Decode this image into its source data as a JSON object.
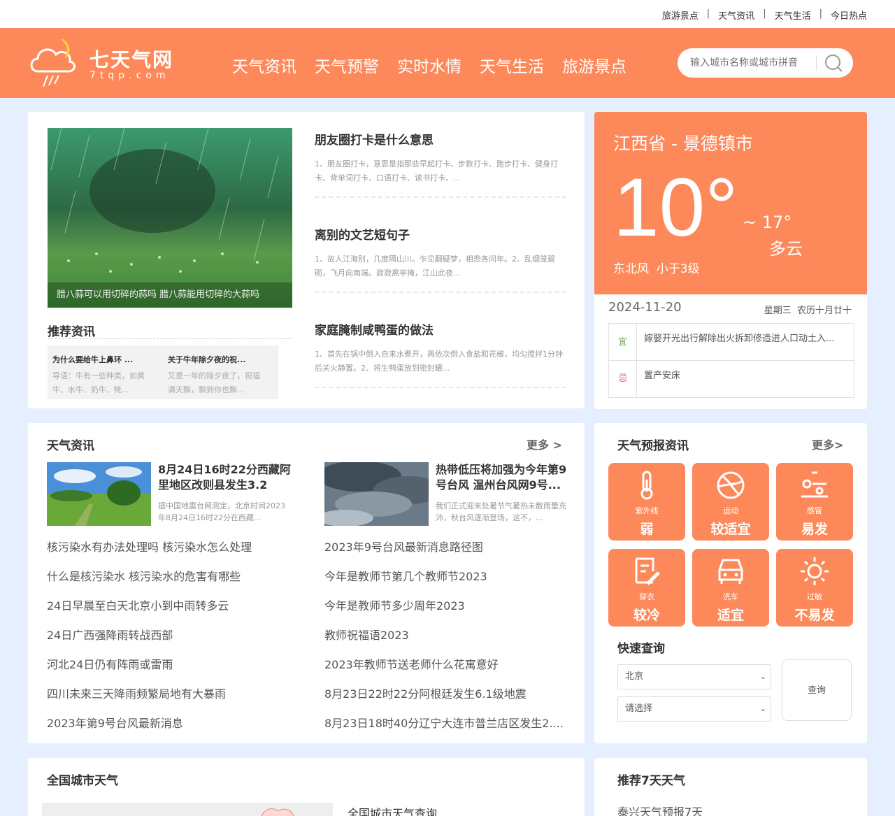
{
  "top_links": [
    "旅游景点",
    "天气资讯",
    "天气生活",
    "今日热点"
  ],
  "top_sep": "|",
  "logo": {
    "title": "七天气网",
    "sub": "7tqp.com"
  },
  "nav": [
    "天气资讯",
    "天气预警",
    "实时水情",
    "天气生活",
    "旅游景点"
  ],
  "search": {
    "placeholder": "输入城市名称或城市拼音"
  },
  "featured": {
    "caption": "腊八蒜可以用切碎的蒜吗 腊八蒜能用切碎的大蒜吗",
    "articles": [
      {
        "title": "朋友圈打卡是什么意思",
        "desc": "1、朋友圈打卡，意思是指那些早起打卡、步数打卡、跑步打卡、健身打卡、背单词打卡、口语打卡、读书打卡、..."
      },
      {
        "title": "离别的文艺短句子",
        "desc": "1、故人江海别，几度隔山川。乍见翻疑梦，相悲各问年。2、乱烟笼碧砌，飞月向南端。寂寂离亭掩，江山此夜..."
      },
      {
        "title": "家庭腌制咸鸭蛋的做法",
        "desc": "1、首先在锅中倒入自来水煮开，再依次倒入食盐和花椒，均匀搅拌1分钟后关火静置。2、将生鸭蛋放到密封罐..."
      }
    ],
    "rec_title": "推荐资讯",
    "rec_items": [
      {
        "title": "为什么要给牛上鼻环 ...",
        "desc": "导语：牛有一些种类，如黄牛、水牛、奶牛、牦..."
      },
      {
        "title": "关于牛年除夕夜的祝...",
        "desc": "又是一年的除夕夜了，祝福满天飘，飘到你也飘..."
      }
    ]
  },
  "weather": {
    "location": "江西省 - 景德镇市",
    "temp": "10°",
    "high": "~ 17°",
    "condition": "多云",
    "wind": "东北风  小于3级",
    "date": "2024-11-20",
    "weekday_lunar": "星期三  农历十月廿十",
    "yi_label": "宜",
    "yi_text": "嫁娶开光出行解除出火拆卸修造进人口动土入...",
    "ji_label": "忌",
    "ji_text": "置产安床",
    "accent": "#fd885a"
  },
  "news": {
    "title": "天气资讯",
    "more": "更多 >",
    "feature1": {
      "title": "8月24日16时22分西藏阿里地区改则县发生3.2级...",
      "desc": "据中国地震台网测定，北京时间2023年8月24日16时22分在西藏..."
    },
    "feature2": {
      "title": "热带低压将加强为今年第9号台风 温州台风网9号...",
      "desc": "我们正式迎来处暑节气暑热未散雨量充沛，秋台风逐渐登场，这不，..."
    },
    "left_list": [
      "核污染水有办法处理吗 核污染水怎么处理",
      "什么是核污染水 核污染水的危害有哪些",
      "24日早晨至白天北京小到中雨转多云",
      "24日广西强降雨转战西部",
      "河北24日仍有阵雨或雷雨",
      "四川未来三天降雨频繁局地有大暴雨",
      "2023年第9号台风最新消息"
    ],
    "right_list": [
      "2023年9号台风最新消息路径图",
      "今年是教师节第几个教师节2023",
      "今年是教师节多少周年2023",
      "教师祝福语2023",
      "2023年教师节送老师什么花寓意好",
      "8月23日22时22分阿根廷发生6.1级地震",
      "8月23日18时40分辽宁大连市普兰店区发生2...."
    ]
  },
  "forecast": {
    "title": "天气预报资讯",
    "more": "更多>",
    "indices": [
      {
        "name": "紫外线",
        "value": "弱",
        "icon": "thermometer-icon"
      },
      {
        "name": "运动",
        "value": "较适宜",
        "icon": "ball-icon"
      },
      {
        "name": "感冒",
        "value": "易发",
        "icon": "cold-icon"
      },
      {
        "name": "穿衣",
        "value": "较冷",
        "icon": "clothing-icon"
      },
      {
        "name": "洗车",
        "value": "适宜",
        "icon": "car-icon"
      },
      {
        "name": "过敏",
        "value": "不易发",
        "icon": "sun-icon"
      }
    ],
    "quick_title": "快速查询",
    "select1": "北京",
    "select2": "请选择",
    "query_btn": "查询"
  },
  "bottom": {
    "city_title": "全国城市天气",
    "city_link": "全国城市天气查询",
    "rec7_title": "推荐7天天气",
    "rec7_item": "泰兴天气预报7天"
  }
}
